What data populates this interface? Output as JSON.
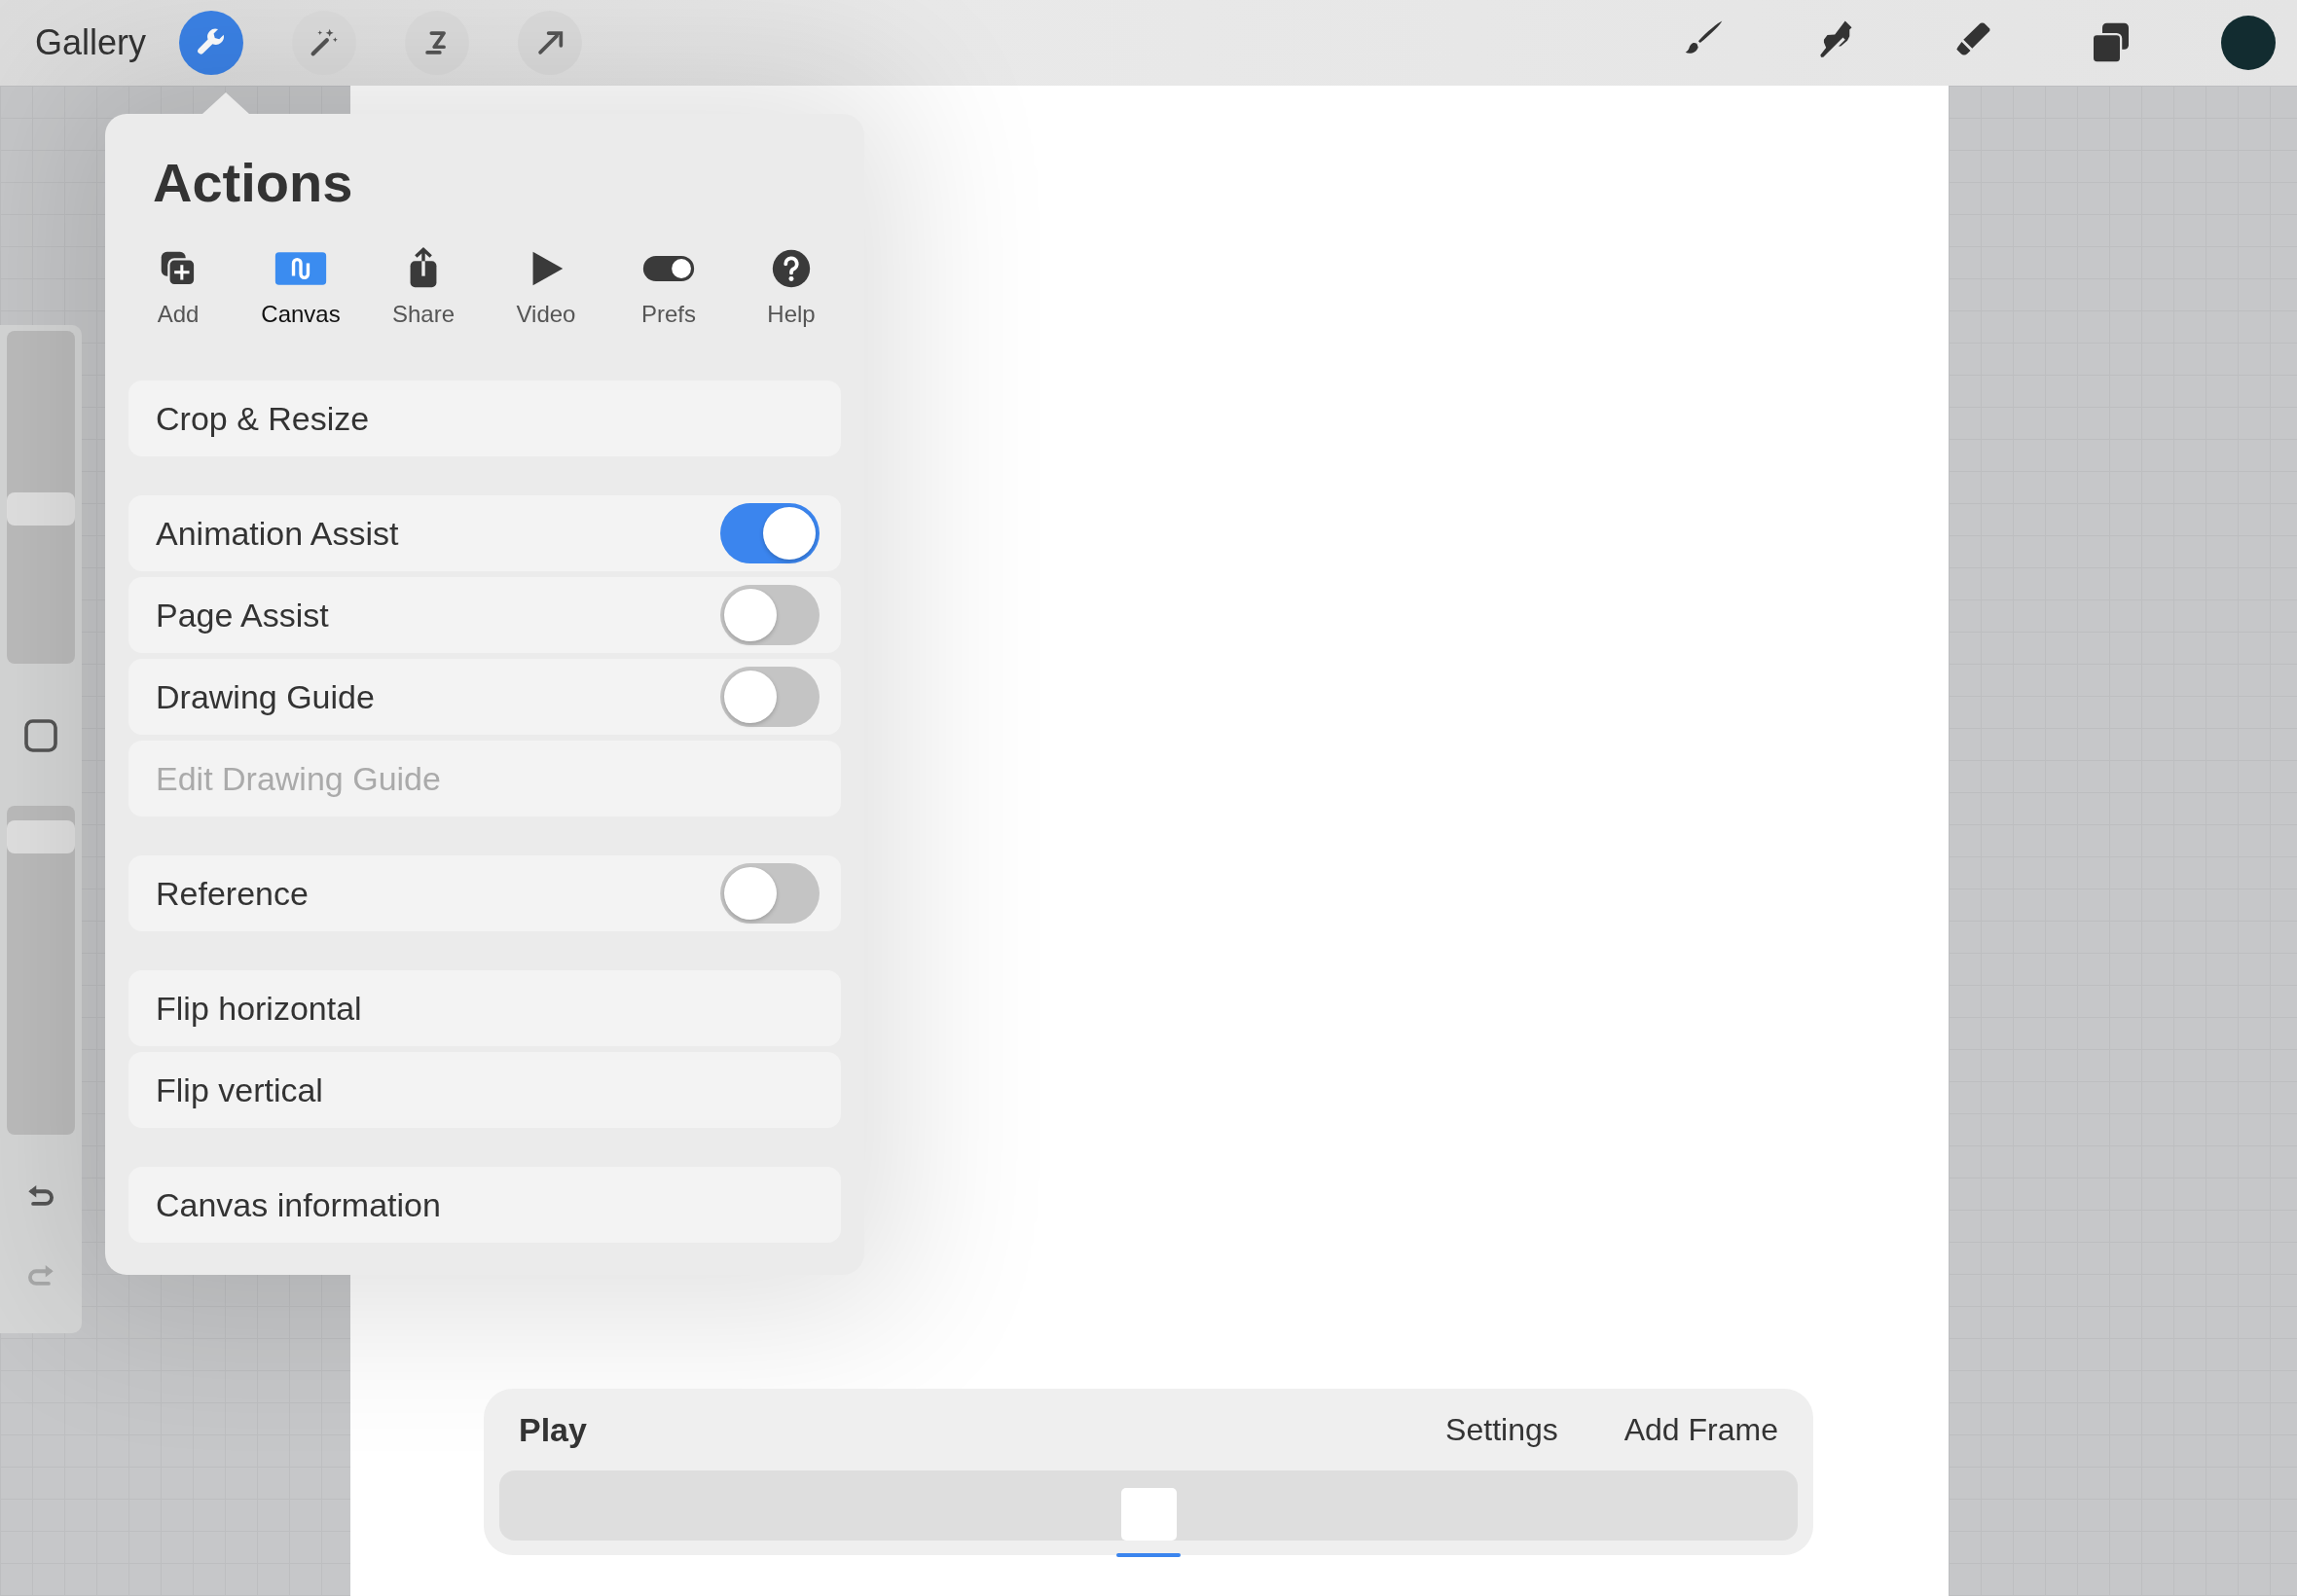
{
  "toolbar": {
    "gallery": "Gallery",
    "tools": [
      {
        "kind": "actions",
        "selected": true
      },
      {
        "kind": "adjustments",
        "selected": false
      },
      {
        "kind": "selection",
        "selected": false
      },
      {
        "kind": "transform",
        "selected": false
      }
    ],
    "painting_tools": [
      {
        "kind": "brush"
      },
      {
        "kind": "smudge"
      },
      {
        "kind": "eraser"
      },
      {
        "kind": "layers"
      }
    ],
    "color": "#122c30"
  },
  "sidebar": {
    "size_slider": {
      "level": 0.46
    },
    "opacity_slider": {
      "level": 0.95
    },
    "undo": {
      "disabled": false
    },
    "redo": {
      "disabled": true
    }
  },
  "actions": {
    "title": "Actions",
    "tabs": [
      {
        "kind": "add",
        "label": "Add",
        "selected": false
      },
      {
        "kind": "canvas",
        "label": "Canvas",
        "selected": true
      },
      {
        "kind": "share",
        "label": "Share",
        "selected": false
      },
      {
        "kind": "video",
        "label": "Video",
        "selected": false
      },
      {
        "kind": "prefs",
        "label": "Prefs",
        "selected": false
      },
      {
        "kind": "help",
        "label": "Help",
        "selected": false
      }
    ],
    "groups": [
      [
        {
          "kind": "button",
          "label": "Crop & Resize",
          "disabled": false
        }
      ],
      [
        {
          "kind": "toggle",
          "label": "Animation Assist",
          "on": true,
          "disabled": false
        },
        {
          "kind": "toggle",
          "label": "Page Assist",
          "on": false,
          "disabled": false
        },
        {
          "kind": "toggle",
          "label": "Drawing Guide",
          "on": false,
          "disabled": false
        },
        {
          "kind": "button",
          "label": "Edit Drawing Guide",
          "disabled": true
        }
      ],
      [
        {
          "kind": "toggle",
          "label": "Reference",
          "on": false,
          "disabled": false
        }
      ],
      [
        {
          "kind": "button",
          "label": "Flip horizontal",
          "disabled": false
        },
        {
          "kind": "button",
          "label": "Flip vertical",
          "disabled": false
        }
      ],
      [
        {
          "kind": "button",
          "label": "Canvas information",
          "disabled": false
        }
      ]
    ]
  },
  "animation": {
    "play": "Play",
    "settings": "Settings",
    "add_frame": "Add Frame",
    "frames": [
      {
        "selected": true
      }
    ]
  }
}
